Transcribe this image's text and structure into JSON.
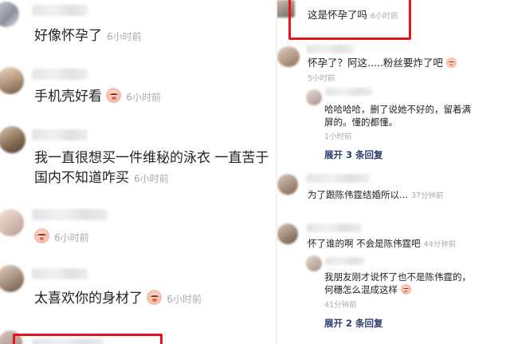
{
  "left_comments": [
    {
      "text": "好像怀孕了",
      "time": "6小时前",
      "emoji": false
    },
    {
      "text": "手机壳好看",
      "time": "6小时前",
      "emoji": true
    },
    {
      "line1": "我一直很想买一件维秘的泳衣 一直苦于",
      "line2": "国内不知道咋买",
      "time": "6小时前"
    },
    {
      "text": "",
      "time": "6小时前",
      "emoji": true
    },
    {
      "text": "太喜欢你的身材了",
      "time": "6小时前",
      "emoji": true
    }
  ],
  "right_comments": [
    {
      "text": "这是怀孕了吗",
      "time": "6小时前"
    },
    {
      "text": "怀孕了？阿这.....粉丝要炸了吧",
      "time": "5小时前",
      "emoji": true
    },
    {
      "line1": "哈哈哈哈，删了说她不好的，留着满",
      "line2": "屏的。懂的都懂。",
      "time": "1小时前"
    },
    {
      "text": "为了跟陈伟霆结婚所以...",
      "time": "37分钟前"
    },
    {
      "text": "怀了谁的啊 不会是陈伟霆吧",
      "time": "44分钟前"
    },
    {
      "line1": "我朋友刚才说怀了也不是陈伟霆的，",
      "line2": "何穗怎么混成这样",
      "time": "41分钟前",
      "emoji": true
    }
  ],
  "reply_links": [
    "展开 3 条回复",
    "展开 2 条回复"
  ],
  "colors": {
    "highlight_border": "#e3141b",
    "link": "#2c3e6e",
    "time": "#aaaaaa"
  }
}
